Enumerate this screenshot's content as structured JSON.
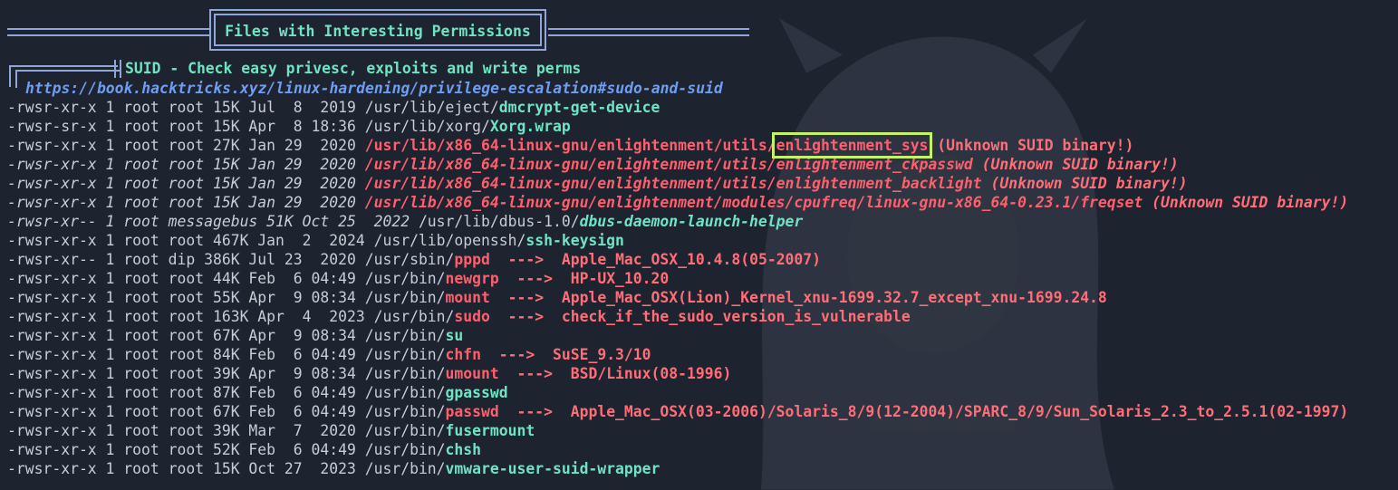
{
  "colors": {
    "background": "#1e2330",
    "banner_border": "#8fa6d8",
    "binary_teal": "#6fe3c4",
    "url_blue": "#6f9df0",
    "alert_red": "#ff5f6d",
    "highlight_green": "#c6f26a",
    "plain_text": "#c8ccd4"
  },
  "banner": {
    "title": "Files with Interesting Permissions"
  },
  "section": {
    "heading": "SUID - Check easy privesc, exploits and write perms",
    "url": "https://book.hacktricks.xyz/linux-hardening/privilege-escalation#sudo-and-suid"
  },
  "lines": [
    {
      "meta": "-rwsr-xr-x 1 root root 15K Jul  8  2019 ",
      "dir": "/usr/lib/eject/",
      "bin": "dmcrypt-get-device",
      "arrow": "",
      "note": ""
    },
    {
      "meta": "-rwsr-sr-x 1 root root 15K Apr  8 18:36 ",
      "dir": "/usr/lib/xorg/",
      "bin": "Xorg.wrap",
      "arrow": "",
      "note": ""
    },
    {
      "meta": "-rwsr-xr-x 1 root root 27K Jan 29  2020 ",
      "dir": "/usr/lib/x86_64-linux-gnu/enlightenment/utils/",
      "bin": "enlightenment_sys",
      "arrow": "",
      "note": " (Unknown SUID binary!)"
    },
    {
      "meta": "-rwsr-xr-x 1 root root 15K Jan 29  2020 ",
      "dir": "/usr/lib/x86_64-linux-gnu/enlightenment/utils/",
      "bin": "enlightenment_ckpasswd",
      "arrow": "",
      "note": " (Unknown SUID binary!)"
    },
    {
      "meta": "-rwsr-xr-x 1 root root 15K Jan 29  2020 ",
      "dir": "/usr/lib/x86_64-linux-gnu/enlightenment/utils/",
      "bin": "enlightenment_backlight",
      "arrow": "",
      "note": " (Unknown SUID binary!)"
    },
    {
      "meta": "-rwsr-xr-x 1 root root 15K Jan 29  2020 ",
      "dir": "/usr/lib/x86_64-linux-gnu/enlightenment/modules/cpufreq/linux-gnu-x86_64-0.23.1/",
      "bin": "freqset",
      "arrow": "",
      "note": " (Unknown SUID binary!)"
    },
    {
      "meta": "-rwsr-xr-- 1 root messagebus 51K Oct 25  2022 ",
      "dir": "/usr/lib/dbus-1.0/",
      "bin": "dbus-daemon-launch-helper",
      "arrow": "",
      "note": ""
    },
    {
      "meta": "-rwsr-xr-x 1 root root 467K Jan  2  2024 ",
      "dir": "/usr/lib/openssh/",
      "bin": "ssh-keysign",
      "arrow": "",
      "note": ""
    },
    {
      "meta": "-rwsr-xr-- 1 root dip 386K Jul 23  2020 ",
      "dir": "/usr/sbin/",
      "bin": "pppd",
      "arrow": "  --->  ",
      "note": "Apple_Mac_OSX_10.4.8(05-2007)"
    },
    {
      "meta": "-rwsr-xr-x 1 root root 44K Feb  6 04:49 ",
      "dir": "/usr/bin/",
      "bin": "newgrp",
      "arrow": "  --->  ",
      "note": "HP-UX_10.20"
    },
    {
      "meta": "-rwsr-xr-x 1 root root 55K Apr  9 08:34 ",
      "dir": "/usr/bin/",
      "bin": "mount",
      "arrow": "  --->  ",
      "note": "Apple_Mac_OSX(Lion)_Kernel_xnu-1699.32.7_except_xnu-1699.24.8"
    },
    {
      "meta": "-rwsr-xr-x 1 root root 163K Apr  4  2023 ",
      "dir": "/usr/bin/",
      "bin": "sudo",
      "arrow": "  --->  ",
      "note": "check_if_the_sudo_version_is_vulnerable"
    },
    {
      "meta": "-rwsr-xr-x 1 root root 67K Apr  9 08:34 ",
      "dir": "/usr/bin/",
      "bin": "su",
      "arrow": "",
      "note": ""
    },
    {
      "meta": "-rwsr-xr-x 1 root root 84K Feb  6 04:49 ",
      "dir": "/usr/bin/",
      "bin": "chfn",
      "arrow": "  --->  ",
      "note": "SuSE_9.3/10"
    },
    {
      "meta": "-rwsr-xr-x 1 root root 39K Apr  9 08:34 ",
      "dir": "/usr/bin/",
      "bin": "umount",
      "arrow": "  --->  ",
      "note": "BSD/Linux(08-1996)"
    },
    {
      "meta": "-rwsr-xr-x 1 root root 87K Feb  6 04:49 ",
      "dir": "/usr/bin/",
      "bin": "gpasswd",
      "arrow": "",
      "note": ""
    },
    {
      "meta": "-rwsr-xr-x 1 root root 67K Feb  6 04:49 ",
      "dir": "/usr/bin/",
      "bin": "passwd",
      "arrow": "  --->  ",
      "note": "Apple_Mac_OSX(03-2006)/Solaris_8/9(12-2004)/SPARC_8/9/Sun_Solaris_2.3_to_2.5.1(02-1997)"
    },
    {
      "meta": "-rwsr-xr-x 1 root root 39K Mar  7  2020 ",
      "dir": "/usr/bin/",
      "bin": "fusermount",
      "arrow": "",
      "note": ""
    },
    {
      "meta": "-rwsr-xr-x 1 root root 52K Feb  6 04:49 ",
      "dir": "/usr/bin/",
      "bin": "chsh",
      "arrow": "",
      "note": ""
    },
    {
      "meta": "-rwsr-xr-x 1 root root 15K Oct 27  2023 ",
      "dir": "/usr/bin/",
      "bin": "vmware-user-suid-wrapper",
      "arrow": "",
      "note": ""
    }
  ]
}
